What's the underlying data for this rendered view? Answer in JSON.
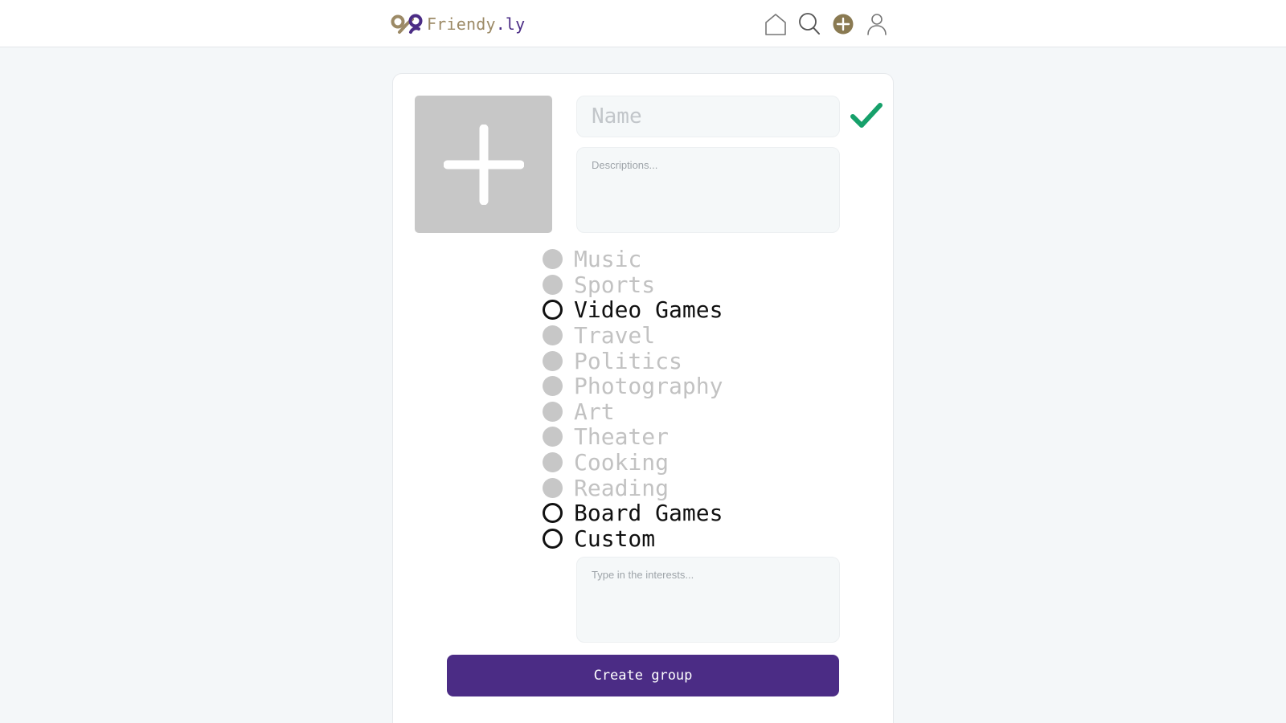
{
  "app": {
    "name": "Friendy",
    "name_suffix": ".ly",
    "brand_color": "#9c8a66",
    "accent_color": "#4b2c85",
    "logo_icon": "friendy-logo-icon"
  },
  "nav": {
    "items": [
      {
        "icon": "home-icon",
        "label": "Home"
      },
      {
        "icon": "search-icon",
        "label": "Search"
      },
      {
        "icon": "add-icon",
        "label": "Add"
      },
      {
        "icon": "profile-icon",
        "label": "Profile"
      }
    ]
  },
  "form": {
    "photo_icon": "plus-icon",
    "name_placeholder": "Name",
    "name_value": "",
    "confirm_icon": "checkmark-icon",
    "confirm_color": "#16a06a",
    "description_placeholder": "Descriptions...",
    "description_value": "",
    "interests": [
      {
        "label": "Music",
        "selected": false
      },
      {
        "label": "Sports",
        "selected": false
      },
      {
        "label": "Video Games",
        "selected": true
      },
      {
        "label": "Travel",
        "selected": false
      },
      {
        "label": "Politics",
        "selected": false
      },
      {
        "label": "Photography",
        "selected": false
      },
      {
        "label": "Art",
        "selected": false
      },
      {
        "label": "Theater",
        "selected": false
      },
      {
        "label": "Cooking",
        "selected": false
      },
      {
        "label": "Reading",
        "selected": false
      },
      {
        "label": "Board Games",
        "selected": true
      },
      {
        "label": "Custom",
        "selected": true
      }
    ],
    "custom_placeholder": "Type in the interests...",
    "custom_value": "",
    "submit_label": "Create group"
  }
}
